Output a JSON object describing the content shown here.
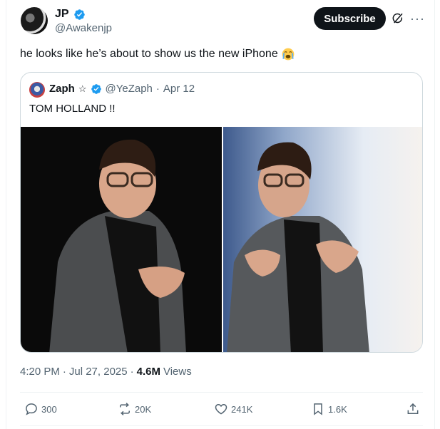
{
  "tweet": {
    "author_name": "JP",
    "author_handle": "@Awakenjp",
    "subscribe_label": "Subscribe",
    "more_label": "···",
    "text": "he looks like he’s about to show us the new iPhone",
    "emoji": "loudly-crying-face",
    "time": "4:20 PM",
    "date": "Jul 27, 2025",
    "views_count": "4.6M",
    "views_label": "Views"
  },
  "quote": {
    "author_name": "Zaph",
    "star": "☆",
    "author_handle": "@YeZaph",
    "date": "Apr 12",
    "text": "TOM HOLLAND !!"
  },
  "actions": {
    "replies": "300",
    "reposts": "20K",
    "likes": "241K",
    "bookmarks": "1.6K"
  },
  "colors": {
    "verified_blue": "#1d9bf0",
    "text_primary": "#0f1419",
    "text_secondary": "#536471",
    "border": "#cfd9de"
  }
}
